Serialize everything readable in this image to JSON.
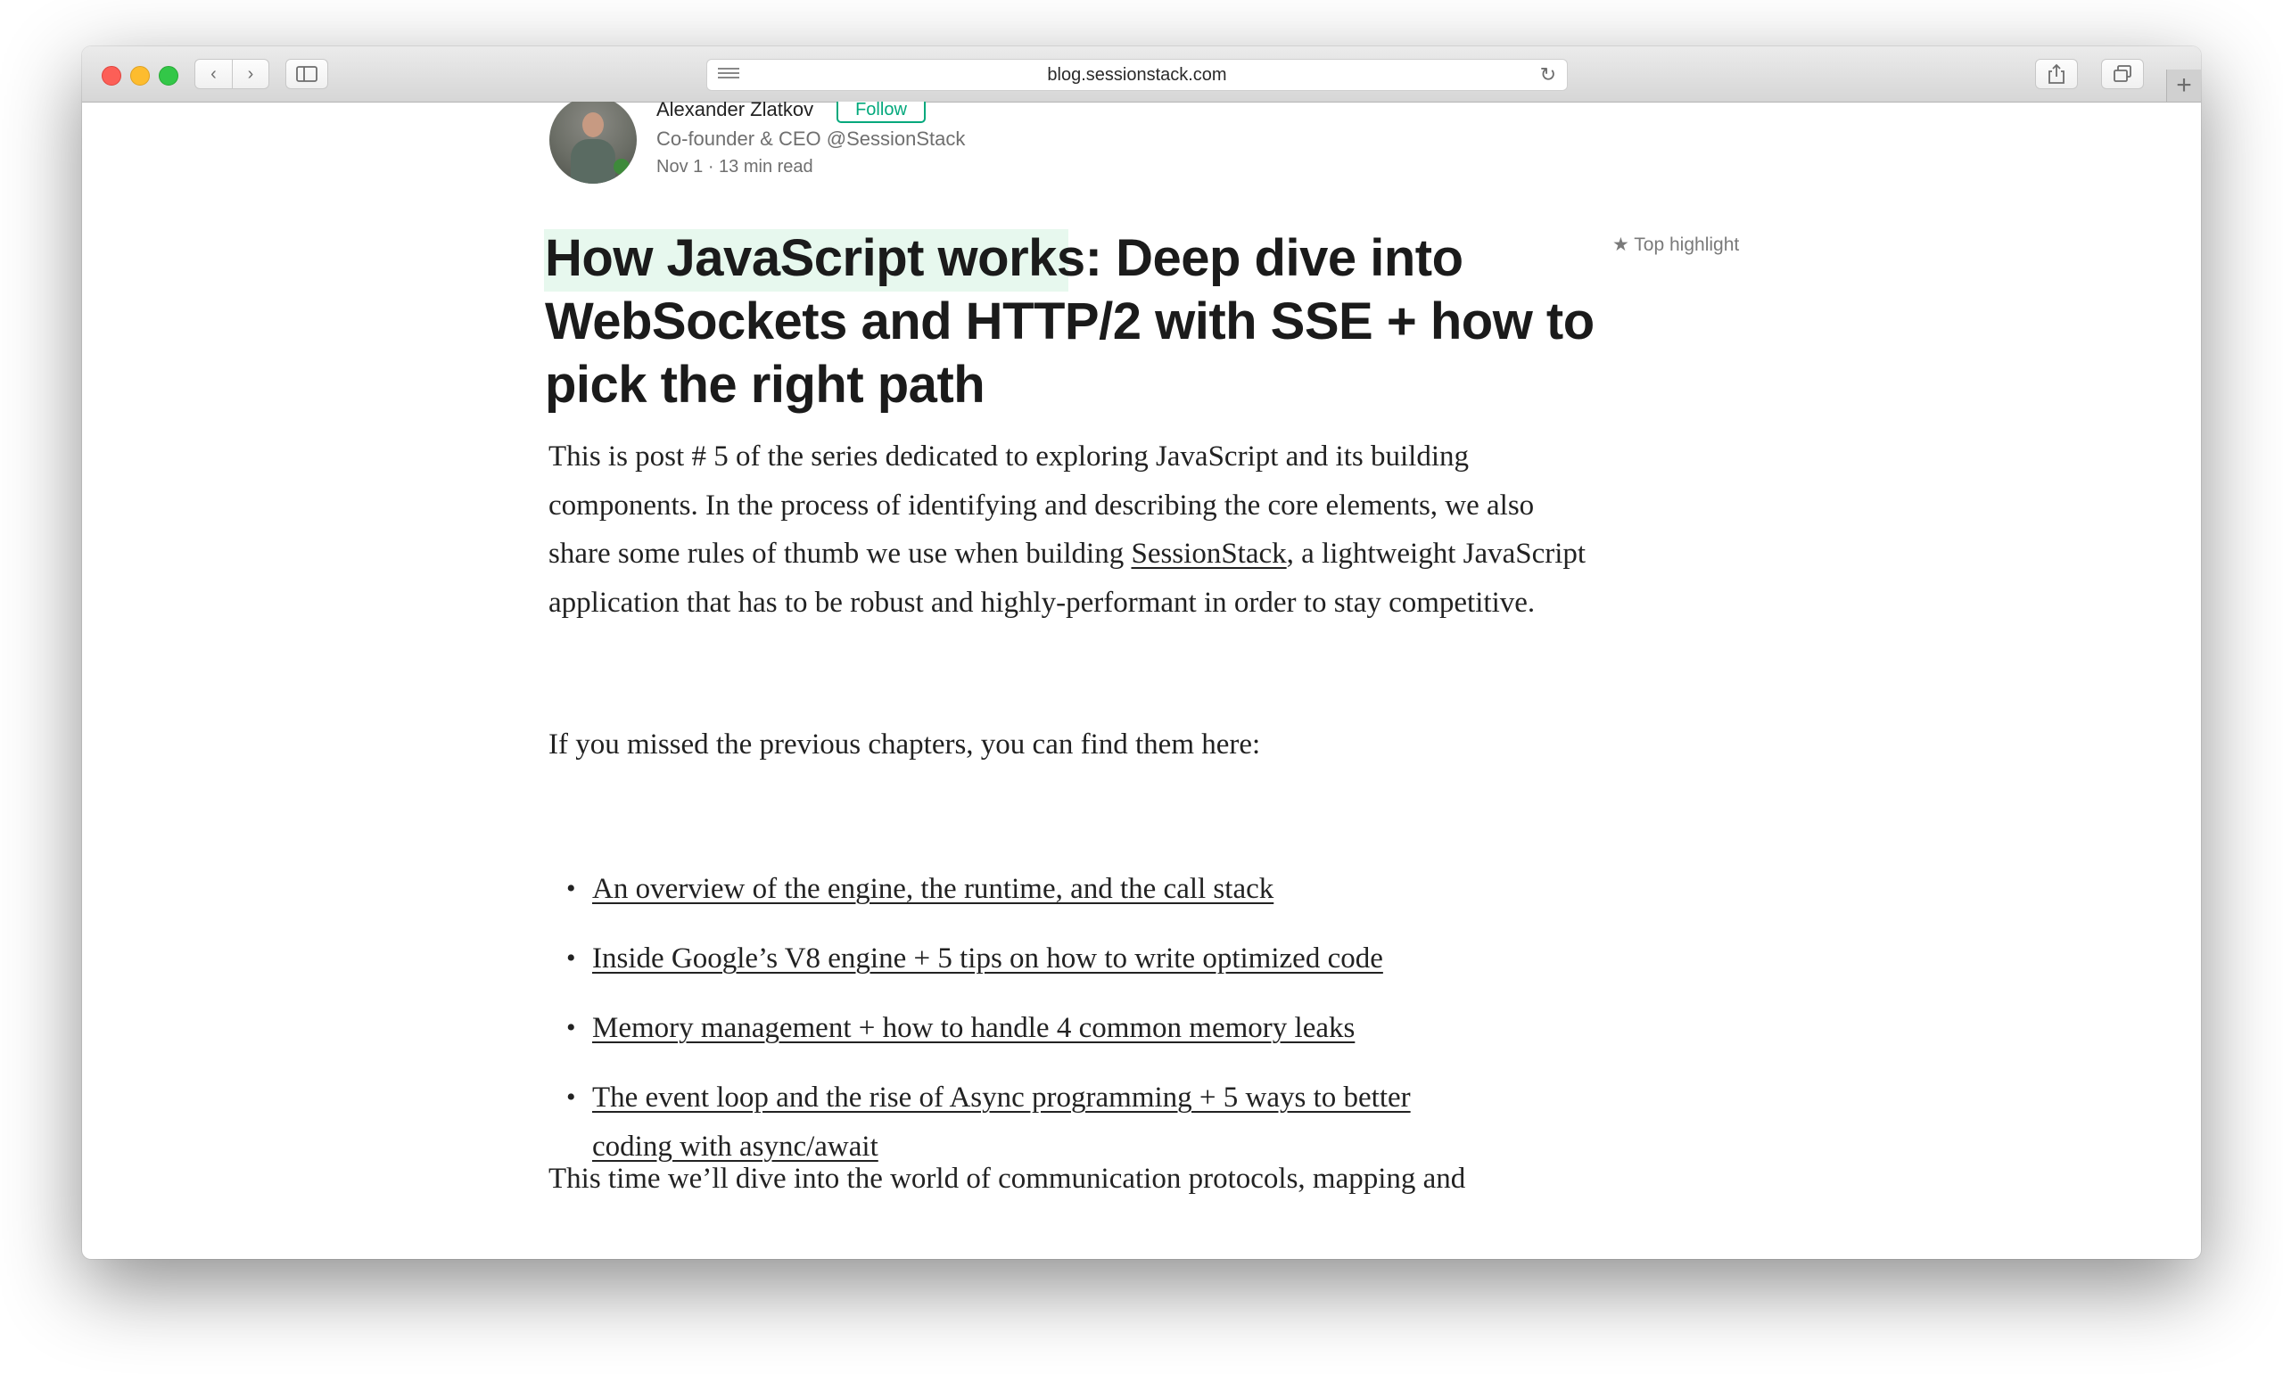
{
  "browser": {
    "url": "blog.sessionstack.com",
    "back_glyph": "‹",
    "forward_glyph": "›",
    "reload_glyph": "↻",
    "new_tab_glyph": "+"
  },
  "author": {
    "name": "Alexander Zlatkov",
    "follow_label": "Follow",
    "bio": "Co-founder & CEO @SessionStack",
    "date": "Nov 1",
    "separator": "·",
    "read_time": "13 min read"
  },
  "article": {
    "title": "How JavaScript works: Deep dive into WebSockets and HTTP/2 with SSE + how to pick the right path",
    "top_highlight": "Top highlight",
    "intro_before_link": "This is post # 5 of the series dedicated to exploring JavaScript and its building components. In the process of identifying and describing the core elements, we also share some rules of thumb we use when building ",
    "intro_link": "SessionStack",
    "intro_after_link": ", a lightweight JavaScript application that has to be robust and highly-performant in order to stay competitive.",
    "previous_intro": "If you missed the previous chapters, you can find them here:",
    "chapters": [
      "An overview of the engine, the runtime, and the call stack",
      "Inside Google’s V8 engine + 5 tips on how to write optimized code",
      "Memory management + how to handle 4 common memory leaks",
      "The event loop and the rise of Async programming + 5 ways to better coding with async/await"
    ],
    "bullet": "•",
    "next_paragraph": "This time we’ll dive into the world of communication protocols, mapping and"
  },
  "colors": {
    "accent_green": "#03a87c",
    "highlight": "#e7f8ee"
  }
}
